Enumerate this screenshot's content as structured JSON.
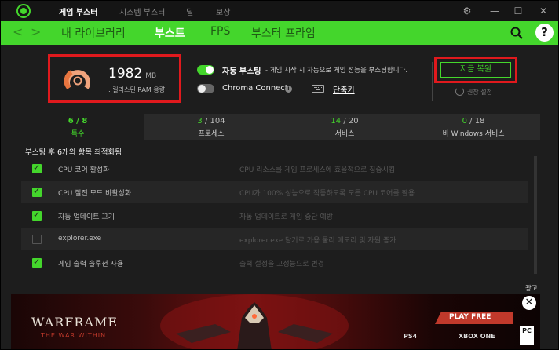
{
  "titlebar": {
    "tabs": [
      {
        "label": "게임 부스터",
        "active": true
      },
      {
        "label": "시스템 부스터",
        "active": false
      },
      {
        "label": "딜",
        "active": false
      },
      {
        "label": "보상",
        "active": false
      }
    ],
    "controls": {
      "settings": "⚙",
      "minimize": "—",
      "maximize": "☐",
      "close": "✕"
    }
  },
  "nav": {
    "back": "<",
    "forward": ">",
    "tabs": [
      {
        "label": "내 라이브러리",
        "active": false
      },
      {
        "label": "부스트",
        "active": true
      },
      {
        "label": "FPS",
        "active": false
      },
      {
        "label": "부스터 프라임",
        "active": false
      }
    ],
    "help": "?"
  },
  "ram": {
    "value": "1982",
    "unit": "MB",
    "label": ": 릴리스된 RAM 용량"
  },
  "options": {
    "auto_boost_label": "자동 부스팅",
    "auto_boost_desc": "- 게임 시작 시 자동으로 게임 성능을 부스팅합니다.",
    "auto_boost_on": true,
    "chroma_label": "Chroma Connect",
    "chroma_on": false,
    "shortcut_label": "단축키"
  },
  "restore": {
    "button_label": "지금 복원",
    "reset_label": "권장 설정"
  },
  "categories": [
    {
      "count": "6",
      "total": "8",
      "name": "특수",
      "active": true
    },
    {
      "count": "3",
      "total": "104",
      "name": "프로세스",
      "active": false
    },
    {
      "count": "14",
      "total": "20",
      "name": "서비스",
      "active": false
    },
    {
      "count": "0",
      "total": "18",
      "name": "비 Windows 서비스",
      "active": false
    }
  ],
  "list": {
    "heading": "부스팅 후 6개의 항목 최적화됨",
    "rows": [
      {
        "name": "CPU 코어 활성화",
        "desc": "CPU 리소스를 게임 프로세스에 효율적으로 집중시킴",
        "checked": true
      },
      {
        "name": "CPU 절전 모드 비활성화",
        "desc": "CPU가 100% 성능으로 작동하도록 모든 CPU 코어를 활용",
        "checked": true
      },
      {
        "name": "자동 업데이트 끄기",
        "desc": "자동 업데이트로 게임 중단 예방",
        "checked": true
      },
      {
        "name": "explorer.exe",
        "desc": "explorer.exe 닫기로 가용 물리 메모리 및 자원 증가",
        "checked": false
      },
      {
        "name": "게임 출력 솔루션 사용",
        "desc": "출력 설정을 고성능으로 변경",
        "checked": true
      }
    ]
  },
  "ad": {
    "label": "광고",
    "close": "✕",
    "title": "WARFRAME",
    "subtitle": "THE WAR WITHIN",
    "cta": "PLAY FREE",
    "platforms": [
      "PS4",
      "XBOX ONE",
      "PC"
    ]
  },
  "colors": {
    "accent": "#44d62c",
    "highlight_box": "#e0191d",
    "background": "#1d1d1d"
  }
}
